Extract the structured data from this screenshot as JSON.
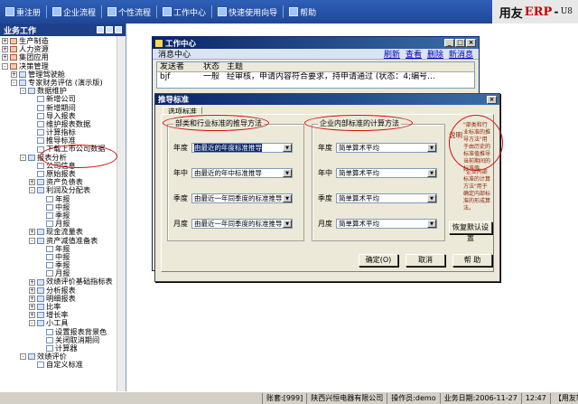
{
  "toolbar": {
    "items": [
      "重注册",
      "企业流程",
      "个性流程",
      "工作中心",
      "快速使用向导",
      "帮助"
    ],
    "brand_name": "用友",
    "brand_product": "ERP",
    "brand_suffix": "-",
    "brand_version": "U8"
  },
  "sidebar": {
    "title": "业务工作",
    "tree": [
      {
        "label": "生产制造",
        "exp": "+",
        "lvl": 0,
        "icon": "red"
      },
      {
        "label": "人力资源",
        "exp": "+",
        "lvl": 0,
        "icon": "red"
      },
      {
        "label": "集团应用",
        "exp": "+",
        "lvl": 0,
        "icon": "red"
      },
      {
        "label": "决策管理",
        "exp": "-",
        "lvl": 0,
        "icon": "red"
      },
      {
        "label": "管理驾驶舱",
        "exp": "+",
        "lvl": 1,
        "icon": "nod"
      },
      {
        "label": "专家财务评估 (演示版)",
        "exp": "-",
        "lvl": 1,
        "icon": "nod"
      },
      {
        "label": "数据维护",
        "exp": "-",
        "lvl": 2,
        "icon": "nod"
      },
      {
        "label": "新增公司",
        "exp": "",
        "lvl": 3,
        "icon": "doc"
      },
      {
        "label": "新增期间",
        "exp": "",
        "lvl": 3,
        "icon": "doc"
      },
      {
        "label": "导入报表",
        "exp": "",
        "lvl": 3,
        "icon": "doc"
      },
      {
        "label": "维护报表数据",
        "exp": "",
        "lvl": 3,
        "icon": "doc"
      },
      {
        "label": "计算指标",
        "exp": "",
        "lvl": 3,
        "icon": "doc"
      },
      {
        "label": "推导标准",
        "exp": "",
        "lvl": 3,
        "icon": "doc"
      },
      {
        "label": "下载上市公司数据",
        "exp": "",
        "lvl": 3,
        "icon": "doc"
      },
      {
        "label": "报表分析",
        "exp": "-",
        "lvl": 2,
        "icon": "nod"
      },
      {
        "label": "公司信息",
        "exp": "",
        "lvl": 3,
        "icon": "doc"
      },
      {
        "label": "原始报表",
        "exp": "",
        "lvl": 3,
        "icon": "doc"
      },
      {
        "label": "资产负债表",
        "exp": "+",
        "lvl": 3,
        "icon": "nod"
      },
      {
        "label": "利润及分配表",
        "exp": "-",
        "lvl": 3,
        "icon": "nod"
      },
      {
        "label": "年报",
        "exp": "",
        "lvl": 4,
        "icon": "doc"
      },
      {
        "label": "中报",
        "exp": "",
        "lvl": 4,
        "icon": "doc"
      },
      {
        "label": "季报",
        "exp": "",
        "lvl": 4,
        "icon": "doc"
      },
      {
        "label": "月报",
        "exp": "",
        "lvl": 4,
        "icon": "doc"
      },
      {
        "label": "现金流量表",
        "exp": "+",
        "lvl": 3,
        "icon": "nod"
      },
      {
        "label": "资产减值准备表",
        "exp": "-",
        "lvl": 3,
        "icon": "nod"
      },
      {
        "label": "年报",
        "exp": "",
        "lvl": 4,
        "icon": "doc"
      },
      {
        "label": "中报",
        "exp": "",
        "lvl": 4,
        "icon": "doc"
      },
      {
        "label": "季报",
        "exp": "",
        "lvl": 4,
        "icon": "doc"
      },
      {
        "label": "月报",
        "exp": "",
        "lvl": 4,
        "icon": "doc"
      },
      {
        "label": "效绩评价基础指标表",
        "exp": "+",
        "lvl": 3,
        "icon": "nod"
      },
      {
        "label": "分析报表",
        "exp": "+",
        "lvl": 3,
        "icon": "nod"
      },
      {
        "label": "明细报表",
        "exp": "+",
        "lvl": 3,
        "icon": "nod"
      },
      {
        "label": "比率",
        "exp": "+",
        "lvl": 3,
        "icon": "nod"
      },
      {
        "label": "增长率",
        "exp": "+",
        "lvl": 3,
        "icon": "nod"
      },
      {
        "label": "小工具",
        "exp": "-",
        "lvl": 3,
        "icon": "nod"
      },
      {
        "label": "设置报表背景色",
        "exp": "",
        "lvl": 4,
        "icon": "doc"
      },
      {
        "label": "关闭取消期间",
        "exp": "",
        "lvl": 4,
        "icon": "doc"
      },
      {
        "label": "计算器",
        "exp": "",
        "lvl": 4,
        "icon": "doc"
      },
      {
        "label": "效绩评价",
        "exp": "-",
        "lvl": 2,
        "icon": "nod"
      },
      {
        "label": "自定义标准",
        "exp": "",
        "lvl": 3,
        "icon": "doc"
      }
    ]
  },
  "workcenter": {
    "title": "工作中心",
    "subtitle": "消息中心",
    "links": [
      "刷新",
      "查看",
      "删除",
      "新消息"
    ],
    "columns": [
      "发送者",
      "状态",
      "主题"
    ],
    "row": {
      "sender": "bjf",
      "status": "一般",
      "subject": "经审核，申请内容符合要求，持申请通过 (状态：4;编号..."
    }
  },
  "dialog": {
    "title": "推导标准",
    "tab": "选项标准",
    "group_left_title": "部类和行业标准的推导方法",
    "group_right_title": "企业内部标准的计算方法",
    "left_fields": [
      {
        "label": "年度",
        "value": "由最近的年度标准推导",
        "highlighted": true
      },
      {
        "label": "年中",
        "value": "由最近的年中标准推导",
        "highlighted": false
      },
      {
        "label": "季度",
        "value": "由最近一年同季度的标准推导",
        "highlighted": false
      },
      {
        "label": "月度",
        "value": "由最近一年同季度的标准推导",
        "highlighted": false
      }
    ],
    "right_fields": [
      {
        "label": "年度",
        "value": "简单算术平均"
      },
      {
        "label": "年中",
        "value": "简单算术平均"
      },
      {
        "label": "季度",
        "value": "简单算术平均"
      },
      {
        "label": "月度",
        "value": "简单算术平均"
      }
    ],
    "note_label": "说明",
    "note_text_1": "\"部类和行业标准的推导方法\"用于由历史的标准值推导当前期间的标准值。",
    "note_text_2": "\"企业内部标准的计算方法\"用于确定内部标准的形成算法。",
    "restore_button": "恢复默认设置",
    "ok_button": "确定(O)",
    "cancel_button": "取消",
    "help_button": "帮 助"
  },
  "statusbar": {
    "account": "账套:[999]",
    "company": "陕西兴恒电器有限公司",
    "operator": "操作员:demo",
    "date": "业务日期:2006-11-27",
    "time": "12:47",
    "brand": "【用友软件】"
  }
}
